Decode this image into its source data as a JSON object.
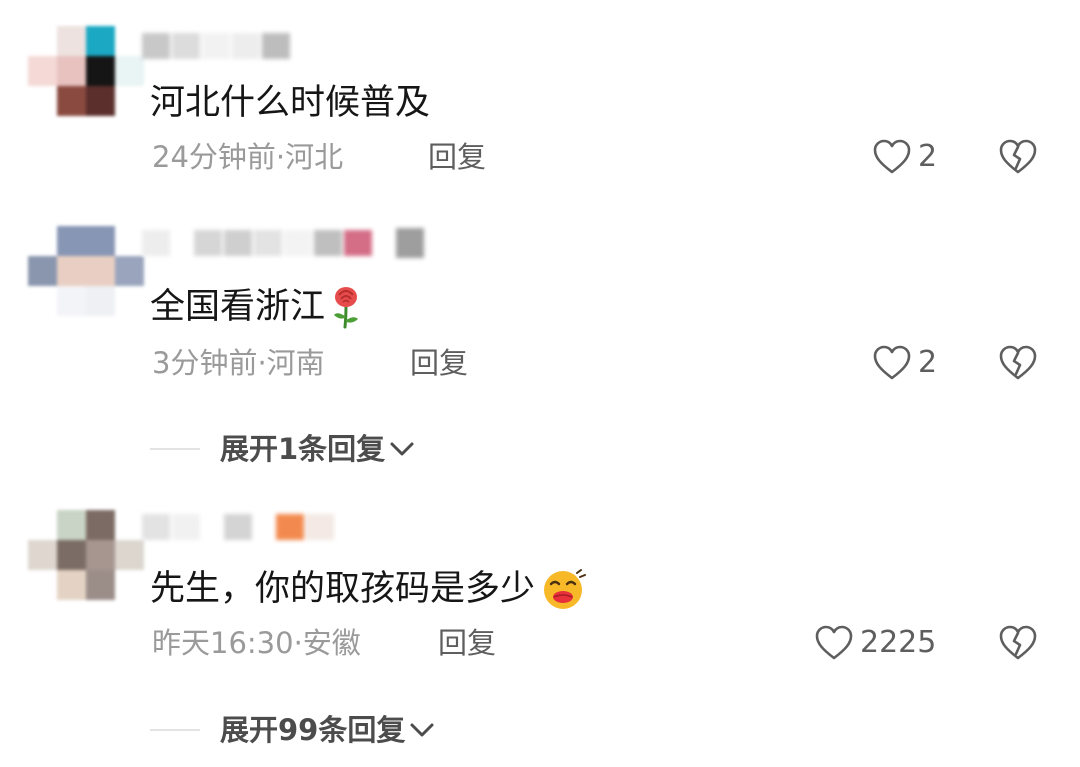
{
  "comments": [
    {
      "text": "河北什么时候普及",
      "time": "24分钟前",
      "location": "河北",
      "meta": "24分钟前·河北",
      "reply_label": "回复",
      "likes": "2",
      "avatar_icon": "user-avatar-icon"
    },
    {
      "text": "全国看浙江",
      "emoji": "rose",
      "time": "3分钟前",
      "location": "河南",
      "meta": "3分钟前·河南",
      "reply_label": "回复",
      "likes": "2",
      "expand_label": "展开1条回复",
      "avatar_icon": "user-avatar-icon"
    },
    {
      "text": "先生，你的取孩码是多少",
      "emoji": "kissing-face",
      "time": "昨天16:30",
      "location": "安徽",
      "meta": "昨天16:30·安徽",
      "reply_label": "回复",
      "likes": "2225",
      "expand_label": "展开99条回复",
      "avatar_icon": "user-avatar-icon"
    }
  ],
  "icons": {
    "like": "heart-outline-icon",
    "dislike": "broken-heart-icon",
    "expand": "chevron-down-icon"
  },
  "colors": {
    "text": "#161616",
    "meta": "#9a9a9a",
    "reply": "#5e5e5e",
    "expand": "#4c4c4c"
  }
}
